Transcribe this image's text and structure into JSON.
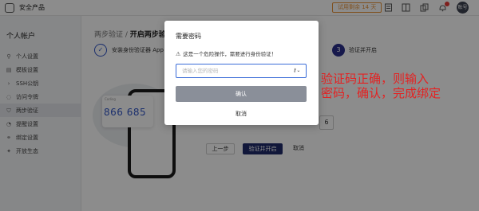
{
  "topbar": {
    "brand": "安全产品",
    "trial": "试用剩余 14 天",
    "avatar": "账号",
    "icons": [
      "doc-icon",
      "panel-icon",
      "copy-icon",
      "bell-icon"
    ]
  },
  "sidebar": {
    "title": "个人帐户",
    "items": [
      {
        "label": "个人设置",
        "icon": "user-icon"
      },
      {
        "label": "模板设置",
        "icon": "template-icon"
      },
      {
        "label": "SSH公钥",
        "icon": "terminal-icon"
      },
      {
        "label": "访问令牌",
        "icon": "token-icon"
      },
      {
        "label": "两步验证",
        "icon": "shield-icon",
        "active": true
      },
      {
        "label": "提醒设置",
        "icon": "bell-icon"
      },
      {
        "label": "绑定设置",
        "icon": "link-icon"
      },
      {
        "label": "开放生态",
        "icon": "grid-icon"
      }
    ]
  },
  "main": {
    "breadcrumb_parent": "两步验证 / ",
    "breadcrumb_current": "开启两步验",
    "step1_label": "安装身份验证器 App",
    "step3_num": "3",
    "step3_label": "验证并开启",
    "code_card_label": "Coding",
    "code_card_num": "866 685",
    "digit_visible": "6",
    "btn_prev": "上一步",
    "btn_verify": "验证并开启",
    "btn_cancel": "取消"
  },
  "dialog": {
    "title": "需要密码",
    "warning": "这是一个危险操作，需要进行身份验证！",
    "input_placeholder": "请输入您的密码",
    "confirm_label": "确认",
    "cancel_label": "取消"
  },
  "annotation": {
    "line1": "验证码正确，则输入",
    "line2": "密码，确认，完成绑定"
  },
  "colors": {
    "accent": "#3257c7",
    "primary_dark": "#1f2a6a",
    "annotation_red": "#e42222",
    "trial_orange": "#e8943a"
  }
}
